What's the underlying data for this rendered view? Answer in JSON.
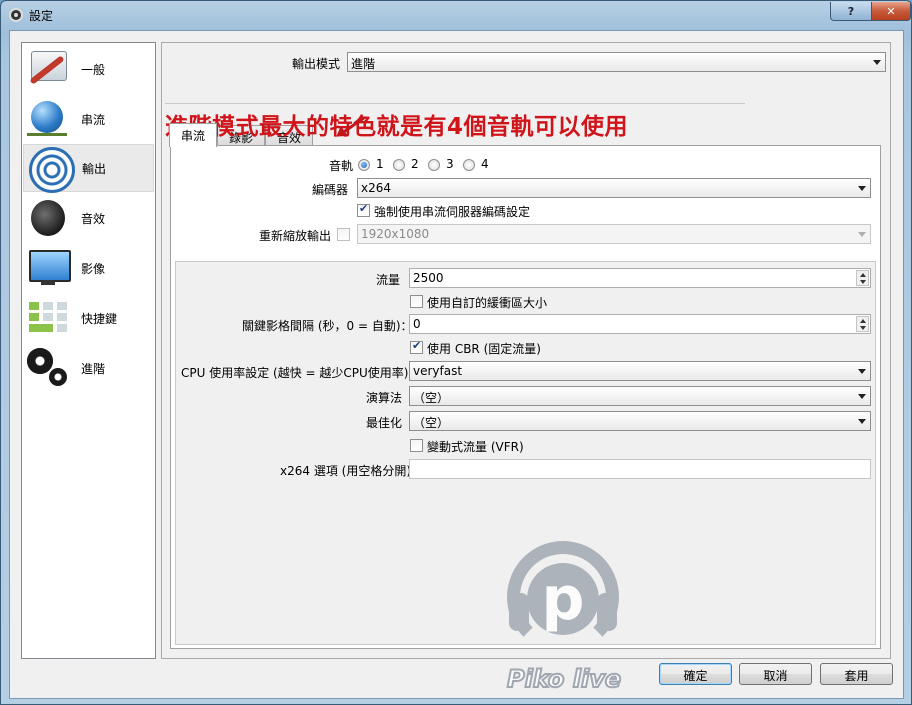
{
  "window": {
    "title": "設定",
    "help_label": "?",
    "close_label": "✕"
  },
  "sidebar": {
    "items": [
      {
        "label": "一般",
        "icon": "general-icon"
      },
      {
        "label": "串流",
        "icon": "stream-icon"
      },
      {
        "label": "輸出",
        "icon": "output-icon",
        "active": true
      },
      {
        "label": "音效",
        "icon": "speaker-icon"
      },
      {
        "label": "影像",
        "icon": "monitor-icon"
      },
      {
        "label": "快捷鍵",
        "icon": "keyboard-icon"
      },
      {
        "label": "進階",
        "icon": "gears-icon"
      }
    ]
  },
  "output_mode": {
    "label": "輸出模式",
    "value": "進階"
  },
  "annotation": {
    "text": "進階模式最大的特色就是有4個音軌可以使用",
    "color": "#d1141a"
  },
  "tabs": [
    {
      "label": "串流",
      "active": true
    },
    {
      "label": "錄影"
    },
    {
      "label": "音效"
    }
  ],
  "streaming": {
    "audio_track_label": "音軌",
    "audio_tracks": [
      "1",
      "2",
      "3",
      "4"
    ],
    "selected_track": "1",
    "encoder_label": "編碼器",
    "encoder_value": "x264",
    "enforce_label": "強制使用串流伺服器編碼設定",
    "rescale_label": "重新縮放輸出",
    "rescale_value": "1920x1080",
    "bitrate_label": "流量",
    "bitrate_value": "2500",
    "custom_buffer_label": "使用自訂的緩衝區大小",
    "keyframe_label": "關鍵影格間隔 (秒，0 = 自動)：",
    "keyframe_value": "0",
    "cbr_label": "使用 CBR (固定流量)",
    "cpu_preset_label": "CPU 使用率設定 (越快 = 越少CPU使用率)",
    "cpu_preset_value": "veryfast",
    "profile_label": "演算法",
    "profile_value": "（空）",
    "tune_label": "最佳化",
    "tune_value": "（空）",
    "vfr_label": "變動式流量 (VFR)",
    "x264_opts_label": "x264 選項 (用空格分開)",
    "x264_opts_value": ""
  },
  "buttons": {
    "ok": "確定",
    "cancel": "取消",
    "apply": "套用"
  },
  "watermark": {
    "text": "Piko live",
    "letter": "p"
  }
}
